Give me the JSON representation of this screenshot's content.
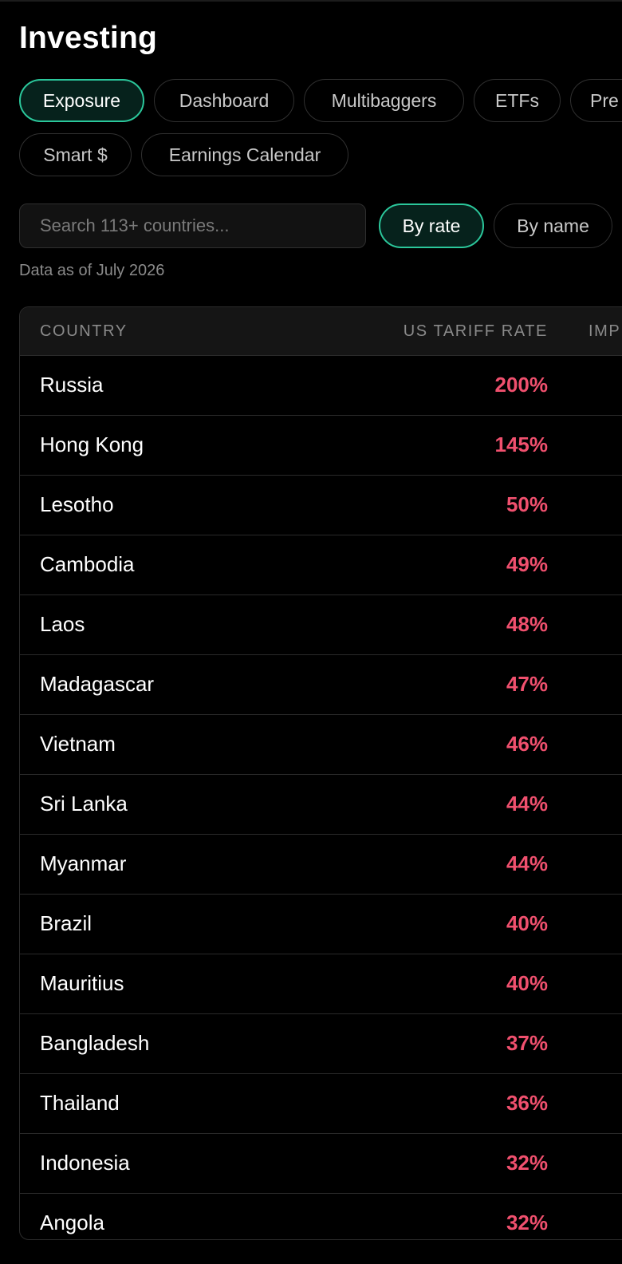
{
  "page": {
    "title": "Investing"
  },
  "tabs": [
    {
      "label": "Exposure",
      "active": true
    },
    {
      "label": "Dashboard",
      "active": false
    },
    {
      "label": "Multibaggers",
      "active": false
    },
    {
      "label": "ETFs",
      "active": false
    },
    {
      "label": "Pre",
      "active": false
    },
    {
      "label": "Smart $",
      "active": false
    },
    {
      "label": "Earnings Calendar",
      "active": false
    }
  ],
  "search": {
    "placeholder": "Search 113+ countries...",
    "value": ""
  },
  "sort": {
    "by_rate": "By rate",
    "by_name": "By name",
    "selected": "By rate"
  },
  "data_as_of": "Data as of July 2026",
  "table": {
    "headers": [
      "COUNTRY",
      "US TARIFF RATE",
      "IMP"
    ],
    "rows": [
      {
        "country": "Russia",
        "rate": "200%"
      },
      {
        "country": "Hong Kong",
        "rate": "145%"
      },
      {
        "country": "Lesotho",
        "rate": "50%"
      },
      {
        "country": "Cambodia",
        "rate": "49%"
      },
      {
        "country": "Laos",
        "rate": "48%"
      },
      {
        "country": "Madagascar",
        "rate": "47%"
      },
      {
        "country": "Vietnam",
        "rate": "46%"
      },
      {
        "country": "Sri Lanka",
        "rate": "44%"
      },
      {
        "country": "Myanmar",
        "rate": "44%"
      },
      {
        "country": "Brazil",
        "rate": "40%"
      },
      {
        "country": "Mauritius",
        "rate": "40%"
      },
      {
        "country": "Bangladesh",
        "rate": "37%"
      },
      {
        "country": "Thailand",
        "rate": "36%"
      },
      {
        "country": "Indonesia",
        "rate": "32%"
      },
      {
        "country": "Angola",
        "rate": "32%"
      }
    ]
  },
  "colors": {
    "accent": "#2bc79b",
    "accent_bg": "#06221c",
    "rate": "#f0506e",
    "background": "#000000"
  }
}
